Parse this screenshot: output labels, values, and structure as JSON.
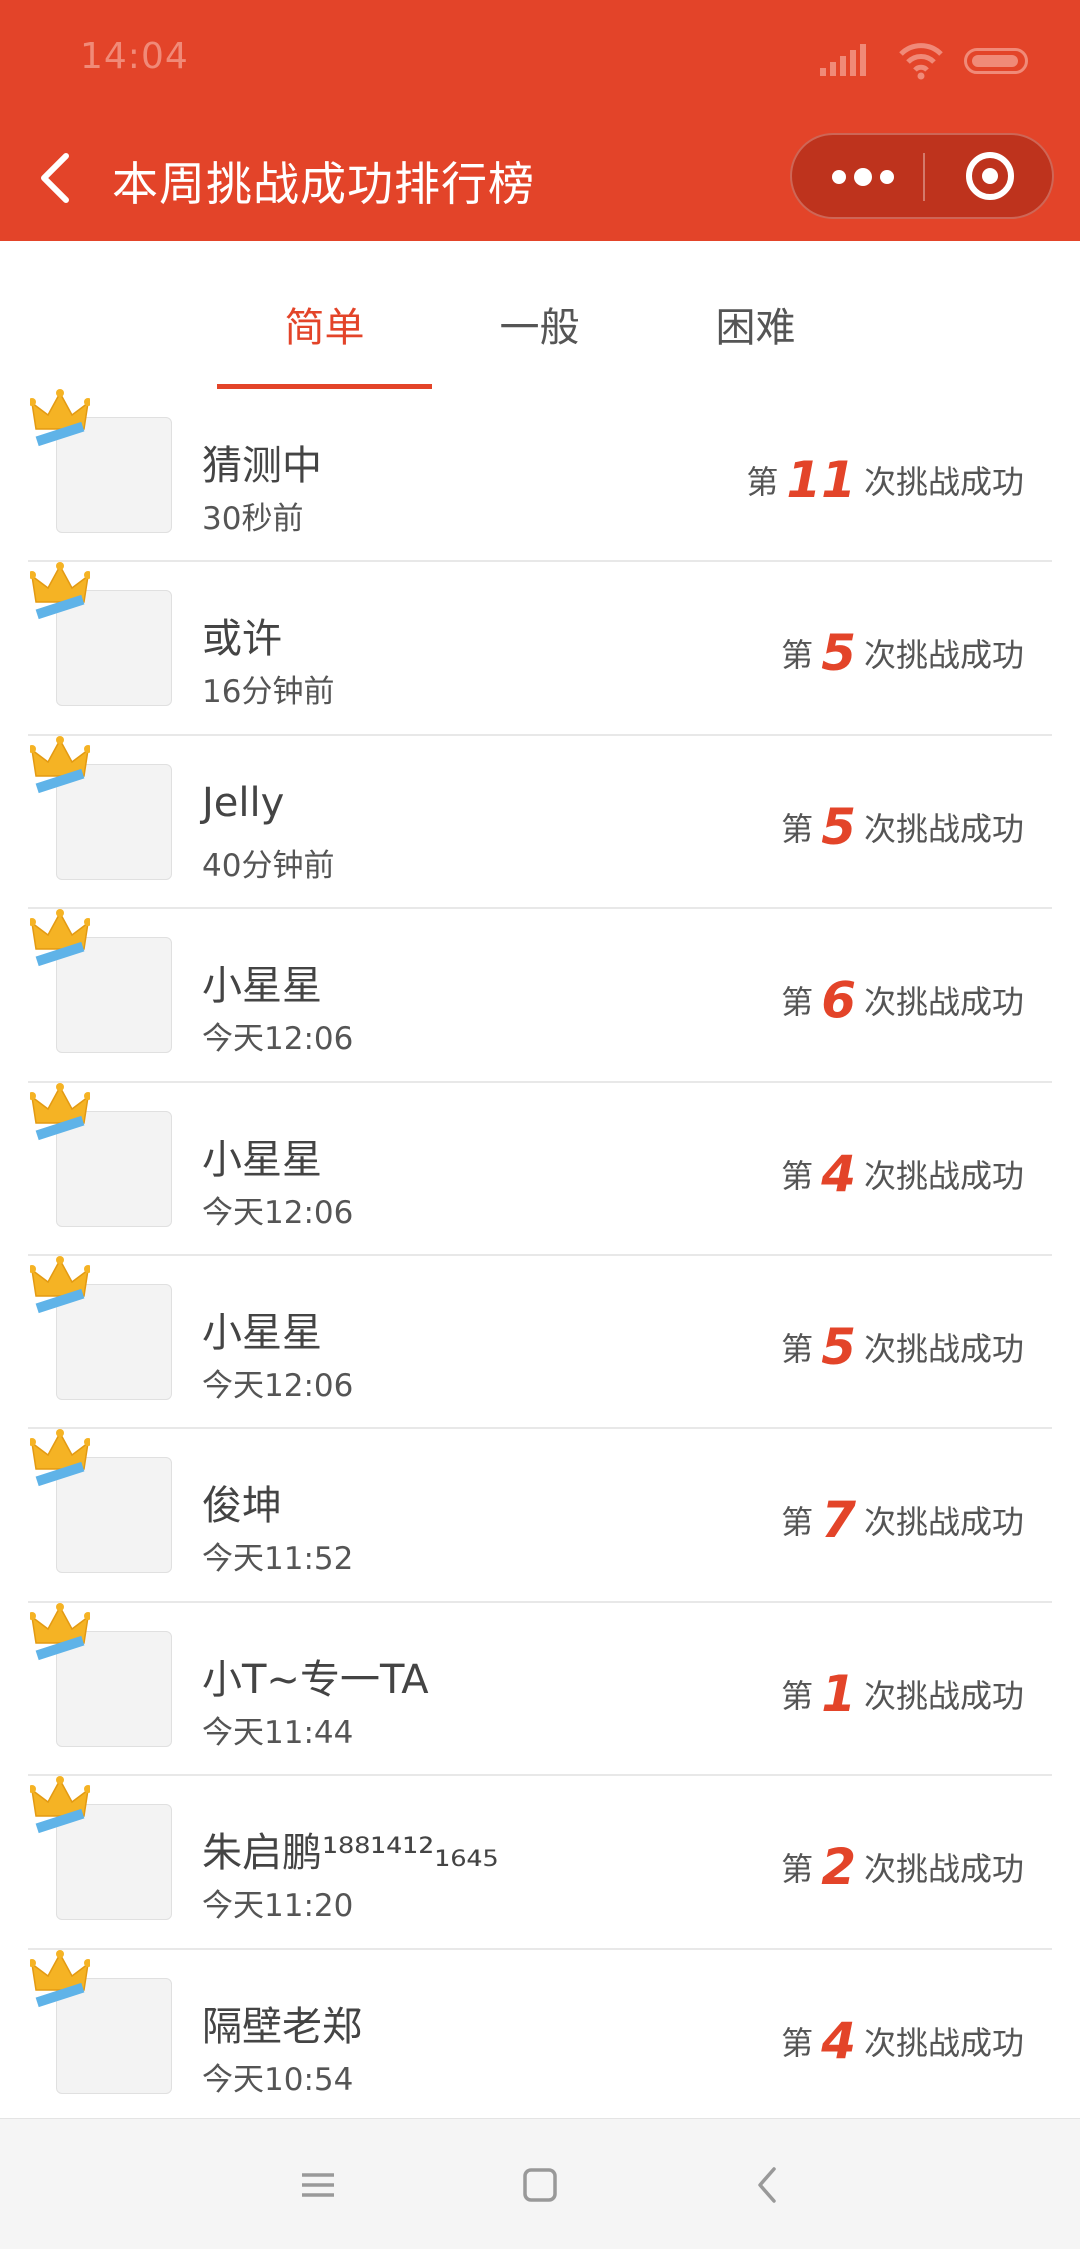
{
  "status_bar": {
    "time": "14:04"
  },
  "header": {
    "title": "本周挑战成功排行榜"
  },
  "tabs": [
    {
      "label": "简单"
    },
    {
      "label": "一般"
    },
    {
      "label": "困难"
    }
  ],
  "result_prefix": "第",
  "result_suffix": "次挑战成功",
  "rows": [
    {
      "name": "猜测中",
      "time": "30秒前",
      "count": "11"
    },
    {
      "name": "或许",
      "time": "16分钟前",
      "count": "5"
    },
    {
      "name": "Jelly",
      "time": "40分钟前",
      "count": "5"
    },
    {
      "name": "小星星",
      "time": "今天12:06",
      "count": "6"
    },
    {
      "name": "小星星",
      "time": "今天12:06",
      "count": "4"
    },
    {
      "name": "小星星",
      "time": "今天12:06",
      "count": "5"
    },
    {
      "name": "俊坤",
      "time": "今天11:52",
      "count": "7"
    },
    {
      "name": "小T~专一TA",
      "time": "今天11:44",
      "count": "1"
    },
    {
      "name": "朱启鹏¹⁸⁸¹⁴¹²₁₆₄₅",
      "time": "今天11:20",
      "count": "2"
    },
    {
      "name": "隔壁老郑",
      "time": "今天10:54",
      "count": "4"
    }
  ],
  "colors": {
    "accent": "#e34429",
    "header_bg": "#e34429"
  }
}
